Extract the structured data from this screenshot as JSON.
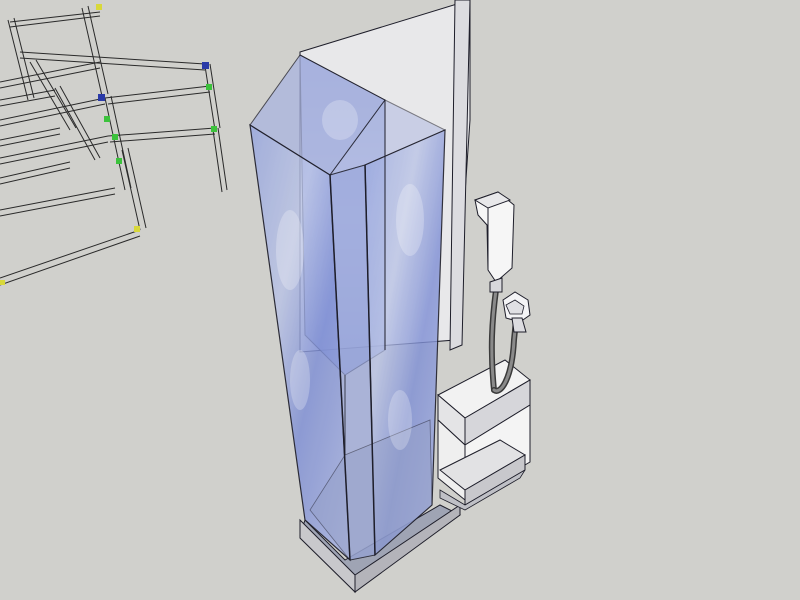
{
  "scene": {
    "background": "#d0d0cc",
    "glass_tint": "#8a9ad8",
    "glass_edge": "#1e1e2a",
    "wall": "#e8e8ea",
    "cabinet": "#ececec",
    "hose": "#4a4a4a",
    "frame_stroke": "#2a2a2a",
    "frame_fill": "#e4e4e2",
    "joint_green": "#3cc23c",
    "joint_yellow": "#d8d83a",
    "joint_blue": "#2a3aa8"
  },
  "objects": {
    "shower_enclosure": "shower-enclosure",
    "partition_wall": "partition-wall",
    "vanity_cabinet": "vanity-cabinet",
    "hand_shower": "hand-shower-head",
    "shower_hose": "shower-hose",
    "scaffold_frame": "scaffold-frame"
  }
}
